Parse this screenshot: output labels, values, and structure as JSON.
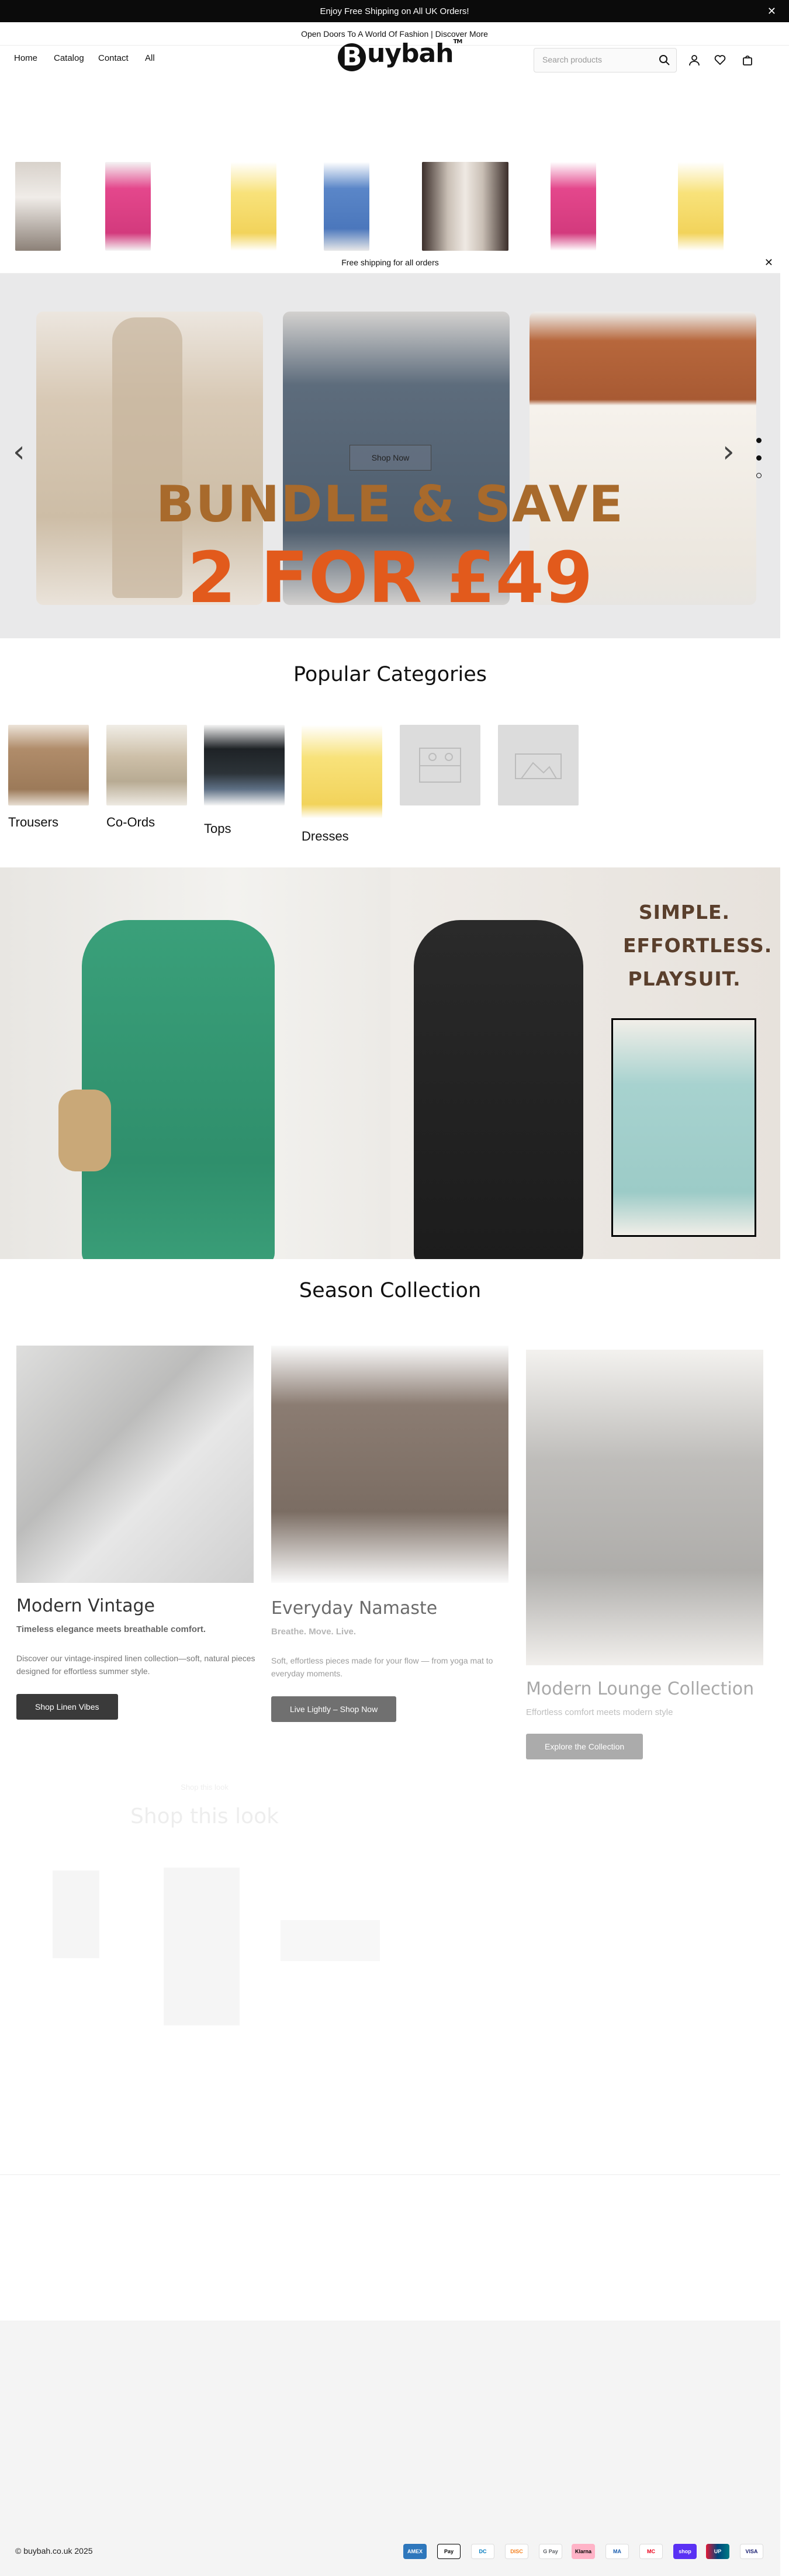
{
  "announcement": {
    "text": "Enjoy Free Shipping on All UK Orders!"
  },
  "subbar": {
    "text": "Open Doors To A World Of Fashion | Discover More"
  },
  "nav": {
    "items": [
      "Home",
      "Catalog",
      "Contact",
      "All"
    ]
  },
  "brand": {
    "logo_letter": "B",
    "logo_rest": "uybah",
    "tm": "TM"
  },
  "search": {
    "placeholder": "Search products"
  },
  "icons": [
    "search-icon",
    "account-icon",
    "heart-icon",
    "bag-icon",
    "close-icon",
    "chevron-left-icon",
    "chevron-right-icon"
  ],
  "free_shipping_bar": {
    "text": "Free shipping for all orders"
  },
  "hero": {
    "button": "Shop Now",
    "headline_1": "BUNDLE & SAVE",
    "headline_2": "2 FOR £49",
    "slide_count": 3,
    "active_slide": 1
  },
  "categories": {
    "title": "Popular Categories",
    "items": [
      "Trousers",
      "Co-Ords",
      "Tops",
      "Dresses",
      "",
      ""
    ]
  },
  "playsuit_banner": {
    "line1": "SIMPLE.",
    "line2": "EFFORTLESS.",
    "line3": "PLAYSUIT."
  },
  "season": {
    "title": "Season Collection",
    "cards": [
      {
        "title": "Modern Vintage",
        "subtitle": "Timeless elegance meets breathable comfort.",
        "desc": "Discover our vintage-inspired linen collection—soft, natural pieces designed for effortless summer style.",
        "button": "Shop Linen Vibes"
      },
      {
        "title": "Everyday Namaste",
        "subtitle": "Breathe. Move. Live.",
        "desc": "Soft, effortless pieces made for your flow — from yoga mat to everyday moments.",
        "button": "Live Lightly – Shop Now"
      },
      {
        "title": "Modern Lounge Collection",
        "subtitle": "Effortless comfort meets modern style",
        "desc": "",
        "button": "Explore the Collection"
      }
    ]
  },
  "shop_look": {
    "eyebrow": "Shop this look",
    "title": "Shop this look"
  },
  "footer": {
    "copyright": "© buybah.co.uk 2025",
    "payments": [
      "AMEX",
      "Pay",
      "DC",
      "DISC",
      "G Pay",
      "Klarna",
      "MA",
      "MC",
      "shop",
      "UP",
      "VISA"
    ]
  },
  "colors": {
    "accent_orange": "#e25a1c",
    "bundle_brown": "#a86a2c",
    "dark": "#0b0b0b",
    "button_dark": "#3a3a3a"
  }
}
